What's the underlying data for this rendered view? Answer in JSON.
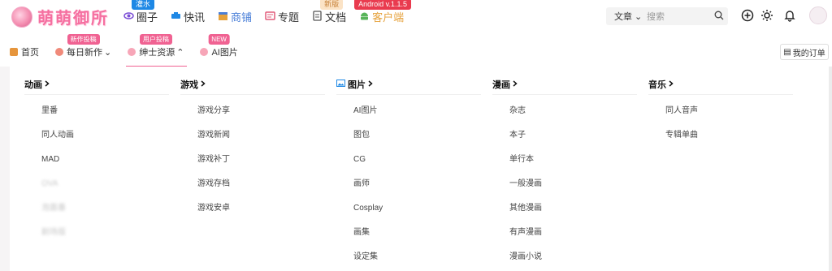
{
  "brand": {
    "name": "萌萌御所"
  },
  "topnav": [
    {
      "label": "圈子",
      "icon": "circle-icon",
      "badge": "灌水",
      "badge_style": "blue",
      "style": ""
    },
    {
      "label": "快讯",
      "icon": "news-icon",
      "badge": "",
      "badge_style": "",
      "style": ""
    },
    {
      "label": "商铺",
      "icon": "shop-icon",
      "badge": "",
      "badge_style": "",
      "style": "blue"
    },
    {
      "label": "专题",
      "icon": "topic-icon",
      "badge": "",
      "badge_style": "",
      "style": ""
    },
    {
      "label": "文档",
      "icon": "doc-icon",
      "badge": "新版",
      "badge_style": "sand",
      "style": ""
    },
    {
      "label": "客户端",
      "icon": "android-icon",
      "badge": "Android v.1.1.5",
      "badge_style": "red",
      "style": "accent"
    }
  ],
  "search": {
    "scope": "文章",
    "placeholder": "搜索"
  },
  "subnav": [
    {
      "label": "首页",
      "badge": "",
      "caret": ""
    },
    {
      "label": "每日新作",
      "badge": "新作投稿",
      "caret": "⌄"
    },
    {
      "label": "绅士资源",
      "badge": "用户投稿",
      "caret": "⌃"
    },
    {
      "label": "AI图片",
      "badge": "NEW",
      "caret": ""
    }
  ],
  "order_button": "我的订单",
  "menu": [
    {
      "heading": "动画",
      "items": [
        "里番",
        "同人动画",
        "MAD",
        "OVA",
        "泡面番",
        "剧场版"
      ],
      "blurred_from": 3
    },
    {
      "heading": "游戏",
      "items": [
        "游戏分享",
        "游戏新闻",
        "游戏补丁",
        "游戏存档",
        "游戏安卓"
      ],
      "blurred_from": 99
    },
    {
      "heading": "图片",
      "items": [
        "AI图片",
        "图包",
        "CG",
        "画师",
        "Cosplay",
        "画集",
        "设定集"
      ],
      "blurred_from": 99
    },
    {
      "heading": "漫画",
      "items": [
        "杂志",
        "本子",
        "单行本",
        "一般漫画",
        "其他漫画",
        "有声漫画",
        "漫画小说"
      ],
      "blurred_from": 99
    },
    {
      "heading": "音乐",
      "items": [
        "同人音声",
        "专辑单曲"
      ],
      "blurred_from": 99
    }
  ],
  "colors": {
    "accent_pink": "#f06292",
    "brand_pink": "#f56fa0",
    "badge_blue": "#1e88e5",
    "badge_red": "#e93b4f"
  }
}
